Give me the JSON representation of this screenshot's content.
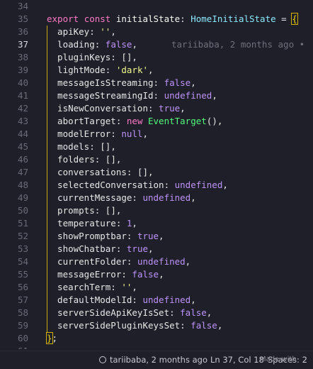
{
  "editor": {
    "lines": [
      {
        "n": "34",
        "tokens": []
      },
      {
        "n": "35",
        "tokens": [
          {
            "c": "kw",
            "t": "export "
          },
          {
            "c": "kw",
            "t": "const "
          },
          {
            "c": "id",
            "t": "initialState"
          },
          {
            "c": "punc",
            "t": ": "
          },
          {
            "c": "type",
            "t": "HomeInitialState"
          },
          {
            "c": "punc",
            "t": " = "
          },
          {
            "c": "brace",
            "t": "{"
          }
        ]
      },
      {
        "n": "36",
        "tokens": [
          {
            "c": "prop",
            "t": "  apiKey: "
          },
          {
            "c": "str",
            "t": "''"
          },
          {
            "c": "punc",
            "t": ","
          }
        ]
      },
      {
        "n": "37",
        "tokens": [
          {
            "c": "prop",
            "t": "  loading: "
          },
          {
            "c": "bool",
            "t": "false"
          },
          {
            "c": "punc",
            "t": ","
          }
        ],
        "active": true,
        "blame": "tariibaba, 2 months ago • "
      },
      {
        "n": "38",
        "tokens": [
          {
            "c": "prop",
            "t": "  pluginKeys: "
          },
          {
            "c": "punc",
            "t": "[],"
          }
        ]
      },
      {
        "n": "39",
        "tokens": [
          {
            "c": "prop",
            "t": "  lightMode: "
          },
          {
            "c": "str",
            "t": "'dark'"
          },
          {
            "c": "punc",
            "t": ","
          }
        ]
      },
      {
        "n": "40",
        "tokens": [
          {
            "c": "prop",
            "t": "  messageIsStreaming: "
          },
          {
            "c": "bool",
            "t": "false"
          },
          {
            "c": "punc",
            "t": ","
          }
        ]
      },
      {
        "n": "41",
        "tokens": [
          {
            "c": "prop",
            "t": "  messageStreamingId: "
          },
          {
            "c": "bool",
            "t": "undefined"
          },
          {
            "c": "punc",
            "t": ","
          }
        ]
      },
      {
        "n": "42",
        "tokens": [
          {
            "c": "prop",
            "t": "  isNewConversation: "
          },
          {
            "c": "bool",
            "t": "true"
          },
          {
            "c": "punc",
            "t": ","
          }
        ]
      },
      {
        "n": "43",
        "tokens": [
          {
            "c": "prop",
            "t": "  abortTarget: "
          },
          {
            "c": "kw",
            "t": "new "
          },
          {
            "c": "func",
            "t": "EventTarget"
          },
          {
            "c": "punc",
            "t": "(),"
          }
        ]
      },
      {
        "n": "44",
        "tokens": [
          {
            "c": "prop",
            "t": "  modelError: "
          },
          {
            "c": "bool",
            "t": "null"
          },
          {
            "c": "punc",
            "t": ","
          }
        ]
      },
      {
        "n": "45",
        "tokens": [
          {
            "c": "prop",
            "t": "  models: "
          },
          {
            "c": "punc",
            "t": "[],"
          }
        ]
      },
      {
        "n": "46",
        "tokens": [
          {
            "c": "prop",
            "t": "  folders: "
          },
          {
            "c": "punc",
            "t": "[],"
          }
        ]
      },
      {
        "n": "47",
        "tokens": [
          {
            "c": "prop",
            "t": "  conversations: "
          },
          {
            "c": "punc",
            "t": "[],"
          }
        ]
      },
      {
        "n": "48",
        "tokens": [
          {
            "c": "prop",
            "t": "  selectedConversation: "
          },
          {
            "c": "bool",
            "t": "undefined"
          },
          {
            "c": "punc",
            "t": ","
          }
        ]
      },
      {
        "n": "49",
        "tokens": [
          {
            "c": "prop",
            "t": "  currentMessage: "
          },
          {
            "c": "bool",
            "t": "undefined"
          },
          {
            "c": "punc",
            "t": ","
          }
        ]
      },
      {
        "n": "50",
        "tokens": [
          {
            "c": "prop",
            "t": "  prompts: "
          },
          {
            "c": "punc",
            "t": "[],"
          }
        ]
      },
      {
        "n": "51",
        "tokens": [
          {
            "c": "prop",
            "t": "  temperature: "
          },
          {
            "c": "num",
            "t": "1"
          },
          {
            "c": "punc",
            "t": ","
          }
        ]
      },
      {
        "n": "52",
        "tokens": [
          {
            "c": "prop",
            "t": "  showPromptbar: "
          },
          {
            "c": "bool",
            "t": "true"
          },
          {
            "c": "punc",
            "t": ","
          }
        ]
      },
      {
        "n": "53",
        "tokens": [
          {
            "c": "prop",
            "t": "  showChatbar: "
          },
          {
            "c": "bool",
            "t": "true"
          },
          {
            "c": "punc",
            "t": ","
          }
        ]
      },
      {
        "n": "54",
        "tokens": [
          {
            "c": "prop",
            "t": "  currentFolder: "
          },
          {
            "c": "bool",
            "t": "undefined"
          },
          {
            "c": "punc",
            "t": ","
          }
        ]
      },
      {
        "n": "55",
        "tokens": [
          {
            "c": "prop",
            "t": "  messageError: "
          },
          {
            "c": "bool",
            "t": "false"
          },
          {
            "c": "punc",
            "t": ","
          }
        ]
      },
      {
        "n": "56",
        "tokens": [
          {
            "c": "prop",
            "t": "  searchTerm: "
          },
          {
            "c": "str",
            "t": "''"
          },
          {
            "c": "punc",
            "t": ","
          }
        ]
      },
      {
        "n": "57",
        "tokens": [
          {
            "c": "prop",
            "t": "  defaultModelId: "
          },
          {
            "c": "bool",
            "t": "undefined"
          },
          {
            "c": "punc",
            "t": ","
          }
        ]
      },
      {
        "n": "58",
        "tokens": [
          {
            "c": "prop",
            "t": "  serverSideApiKeyIsSet: "
          },
          {
            "c": "bool",
            "t": "false"
          },
          {
            "c": "punc",
            "t": ","
          }
        ]
      },
      {
        "n": "59",
        "tokens": [
          {
            "c": "prop",
            "t": "  serverSidePluginKeysSet: "
          },
          {
            "c": "bool",
            "t": "false"
          },
          {
            "c": "punc",
            "t": ","
          }
        ]
      },
      {
        "n": "60",
        "tokens": [
          {
            "c": "brace",
            "t": "}"
          },
          {
            "c": "punc",
            "t": ";"
          }
        ]
      },
      {
        "n": "61",
        "tokens": []
      }
    ]
  },
  "statusbar": {
    "blame": "tariibaba, 2 months ago",
    "position": "Ln 37, Col 18",
    "spaces": "Spaces: 2",
    "overlay": "Made with"
  },
  "colors": {
    "background": "#1f1f29",
    "keyword": "#ff79c6",
    "type": "#8be9fd",
    "string": "#f1fa8c",
    "constant": "#bd93f9",
    "function": "#50fa7b",
    "bracket_highlight": "#d4b000"
  },
  "icons": {
    "branch": "git-commit-icon"
  }
}
